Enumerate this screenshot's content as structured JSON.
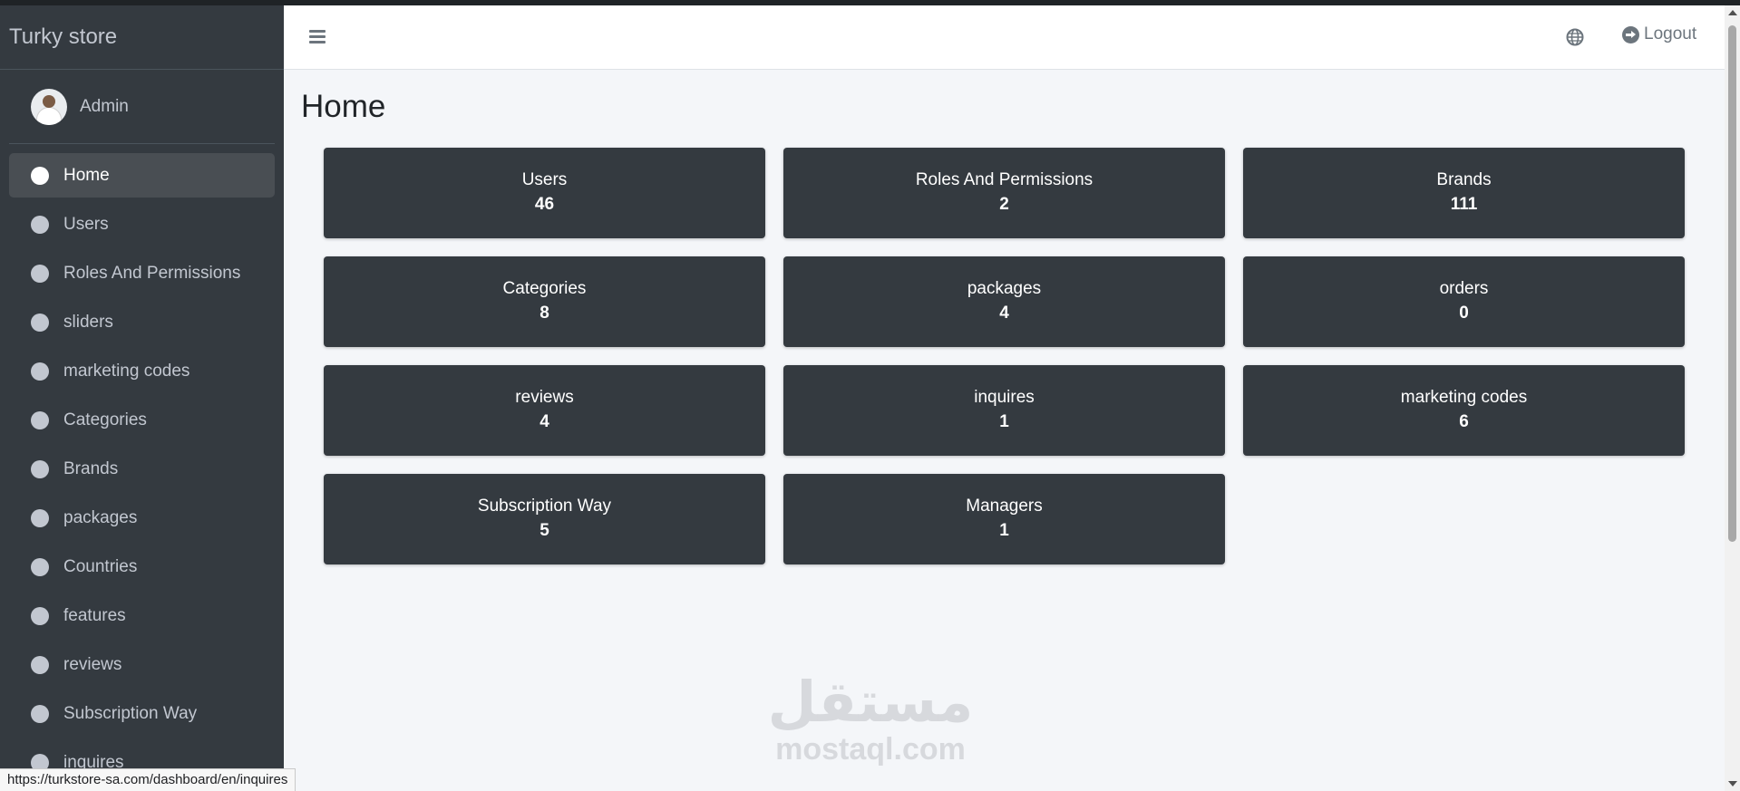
{
  "sidebar": {
    "brand": "Turky store",
    "user_name": "Admin",
    "items": [
      {
        "label": "Home",
        "active": true
      },
      {
        "label": "Users"
      },
      {
        "label": "Roles And Permissions"
      },
      {
        "label": "sliders"
      },
      {
        "label": "marketing codes"
      },
      {
        "label": "Categories"
      },
      {
        "label": "Brands"
      },
      {
        "label": "packages"
      },
      {
        "label": "Countries"
      },
      {
        "label": "features"
      },
      {
        "label": "reviews"
      },
      {
        "label": "Subscription Way"
      },
      {
        "label": "inquires"
      }
    ]
  },
  "header": {
    "menu_icon": "hamburger-icon",
    "language_icon": "globe-icon",
    "logout_icon": "sign-out-icon",
    "logout_label": "Logout"
  },
  "main": {
    "title": "Home",
    "cards": [
      {
        "title": "Users",
        "value": "46"
      },
      {
        "title": "Roles And Permissions",
        "value": "2"
      },
      {
        "title": "Brands",
        "value": "111"
      },
      {
        "title": "Categories",
        "value": "8"
      },
      {
        "title": "packages",
        "value": "4"
      },
      {
        "title": "orders",
        "value": "0"
      },
      {
        "title": "reviews",
        "value": "4"
      },
      {
        "title": "inquires",
        "value": "1"
      },
      {
        "title": "marketing codes",
        "value": "6"
      },
      {
        "title": "Subscription Way",
        "value": "5"
      },
      {
        "title": "Managers",
        "value": "1"
      }
    ]
  },
  "watermark": {
    "arabic": "مستقل",
    "latin": "mostaql.com"
  },
  "status_bar": {
    "url": "https://turkstore-sa.com/dashboard/en/inquires"
  },
  "colors": {
    "sidebar_bg": "#343a40",
    "card_bg": "#343a40",
    "content_bg": "#f4f6f9",
    "active_item_bg": "#494e53"
  }
}
